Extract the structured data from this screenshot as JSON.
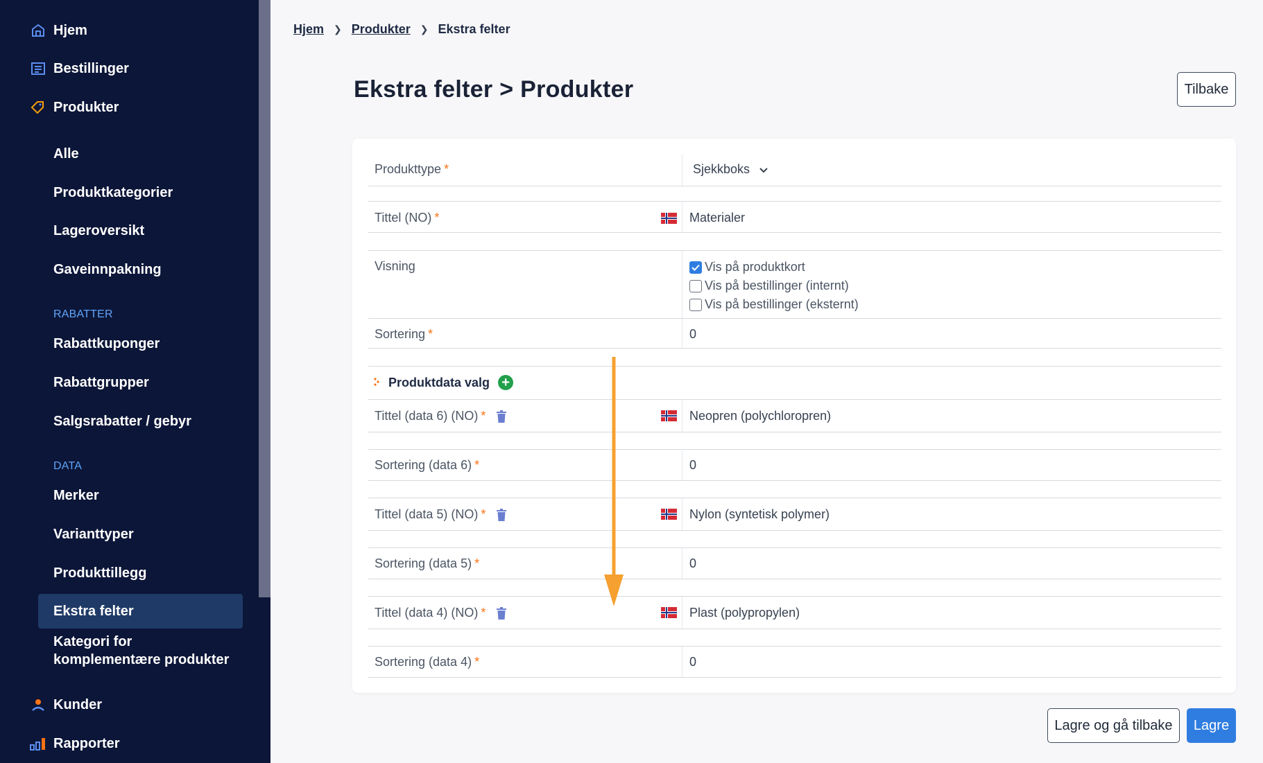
{
  "sidebar": {
    "top_items": [
      {
        "label": "Hjem",
        "icon": "home-icon"
      },
      {
        "label": "Bestillinger",
        "icon": "orders-icon"
      },
      {
        "label": "Produkter",
        "icon": "tag-icon"
      }
    ],
    "product_items": [
      "Alle",
      "Produktkategorier",
      "Lageroversikt",
      "Gaveinnpakning"
    ],
    "section_discounts": "RABATTER",
    "discount_items": [
      "Rabattkuponger",
      "Rabattgrupper",
      "Salgsrabatter / gebyr"
    ],
    "section_data": "DATA",
    "data_items": [
      "Merker",
      "Varianttyper",
      "Produkttillegg",
      "Ekstra felter"
    ],
    "data_item_multi": [
      "Kategori for",
      "komplementære produkter"
    ],
    "bottom_items": [
      {
        "label": "Kunder",
        "icon": "user-icon"
      },
      {
        "label": "Rapporter",
        "icon": "chart-icon"
      }
    ],
    "accent_color": "#60a5fa"
  },
  "breadcrumb": {
    "home": "Hjem",
    "products": "Produkter",
    "current": "Ekstra felter"
  },
  "page": {
    "title": "Ekstra felter > Produkter",
    "back_button": "Tilbake"
  },
  "form": {
    "product_type_label": "Produkttype",
    "product_type_value": "Sjekkboks",
    "title_label": "Tittel (NO)",
    "title_value": "Materialer",
    "display_label": "Visning",
    "display_options": [
      {
        "label": "Vis på produktkort",
        "checked": true
      },
      {
        "label": "Vis på bestillinger (internt)",
        "checked": false
      },
      {
        "label": "Vis på bestillinger (eksternt)",
        "checked": false
      }
    ],
    "sort_label": "Sortering",
    "sort_value": "0",
    "required_marker": "*"
  },
  "product_data": {
    "heading": "Produktdata valg",
    "entries": [
      {
        "title_label": "Tittel (data 6) (NO)",
        "title_value": "Neopren (polychloropren)",
        "sort_label": "Sortering (data 6)",
        "sort_value": "0"
      },
      {
        "title_label": "Tittel (data 5) (NO)",
        "title_value": "Nylon (syntetisk polymer)",
        "sort_label": "Sortering (data 5)",
        "sort_value": "0"
      },
      {
        "title_label": "Tittel (data 4) (NO)",
        "title_value": "Plast (polypropylen)",
        "sort_label": "Sortering (data 4)",
        "sort_value": "0"
      }
    ]
  },
  "actions": {
    "save_back": "Lagre og gå tilbake",
    "save": "Lagre"
  },
  "colors": {
    "sidebar_bg": "#0c1638",
    "primary": "#2f7de1",
    "required": "#f97316",
    "arrow": "#f5a030",
    "add": "#22a04b"
  }
}
